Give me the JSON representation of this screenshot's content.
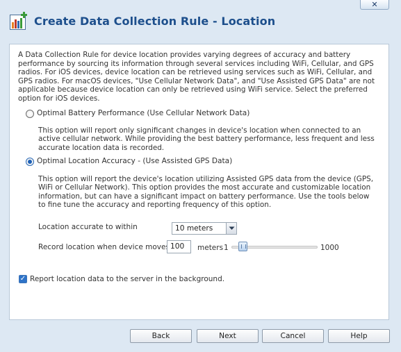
{
  "window": {
    "title": "Create Data Collection Rule - Location",
    "close_symbol": "✕",
    "icon": "chart-icon"
  },
  "intro_text": "A Data Collection Rule for device location provides varying degrees of accuracy and battery performance by sourcing its information through several services including WiFi, Cellular, and GPS radios. For iOS devices, device location can be retrieved using services such as WiFi, Cellular, and GPS radios. For macOS devices, \"Use Cellular Network Data\", and \"Use Assisted GPS Data\" are not applicable because device location can only be retrieved using WiFi service. Select the preferred option for iOS devices.",
  "options": [
    {
      "label": "Optimal Battery Performance (Use Cellular Network Data)",
      "description": "This option will report only significant changes in device's location when connected to an active cellular network. While providing the best battery performance, less frequent and less accurate location data is recorded.",
      "selected": false
    },
    {
      "label": "Optimal Location Accuracy - (Use Assisted GPS Data)",
      "description": "This option will report the device's location utilizing Assisted GPS data from the device (GPS, WiFi or Cellular Network). This option provides the most accurate and customizable location information, but can have a significant impact on battery performance. Use the tools below to fine tune the accuracy and reporting frequency of this option.",
      "selected": true
    }
  ],
  "accuracy": {
    "label": "Location accurate to within",
    "value": "10 meters"
  },
  "movement": {
    "label": "Record location when device moves",
    "value": "100",
    "unit_label": "meters",
    "min_label": "1",
    "max_label": "1000",
    "slider_value": 100
  },
  "background_report": {
    "label": "Report location data to the server in the background.",
    "checked": true,
    "check_symbol": "✓"
  },
  "buttons": {
    "back": "Back",
    "next": "Next",
    "cancel": "Cancel",
    "help": "Help"
  },
  "colors": {
    "title": "#1d4f8c",
    "accent": "#1c5fb5",
    "background": "#dde8f3"
  }
}
